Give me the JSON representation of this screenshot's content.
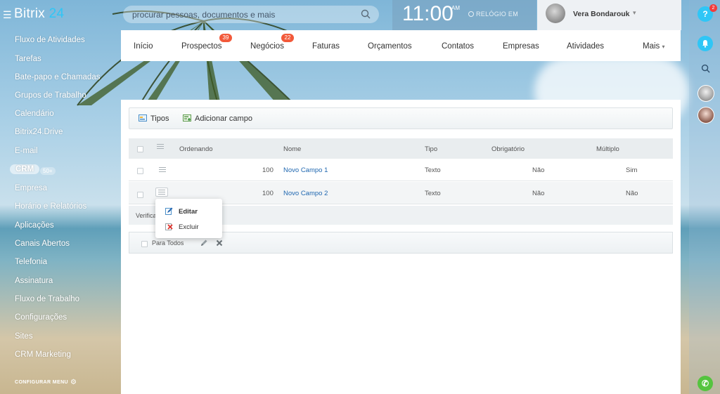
{
  "header": {
    "logo_text": "Bitrix",
    "logo_num": "24",
    "search_placeholder": "procurar pessoas, documentos e mais",
    "clock_time": "11:00",
    "clock_ampm": "AM",
    "clock_label": "RELÓGIO EM",
    "user_name": "Vera Bondarouk"
  },
  "left_menu": {
    "items": [
      "Fluxo de Atividades",
      "Tarefas",
      "Bate-papo e Chamadas",
      "Grupos de Trabalho",
      "Calendário",
      "Bitrix24.Drive",
      "E-mail",
      "CRM",
      "Empresa",
      "Horário e Relatórios",
      "Aplicações",
      "Canais Abertos",
      "Telefonia",
      "Assinatura",
      "Fluxo de Trabalho",
      "Configurações",
      "Sites",
      "CRM Marketing"
    ],
    "crm_badge": "50+",
    "configure_label": "CONFIGURAR MENU"
  },
  "right_panel": {
    "help_icon": "question-icon",
    "help_badge": "2"
  },
  "top_nav": {
    "items": [
      "Início",
      "Prospectos",
      "Negócios",
      "Faturas",
      "Orçamentos",
      "Contatos",
      "Empresas",
      "Atividades",
      "Mais"
    ],
    "prospectos_counter": "39",
    "negocios_counter": "22"
  },
  "toolbar": {
    "types_label": "Tipos",
    "add_field_label": "Adicionar campo"
  },
  "grid": {
    "columns": [
      "Ordenando",
      "Nome",
      "Tipo",
      "Obrigatório",
      "Múltiplo"
    ],
    "rows": [
      {
        "order": "100",
        "name": "Novo Campo 1",
        "type": "Texto",
        "required": "Não",
        "multiple": "Sim"
      },
      {
        "order": "100",
        "name": "Novo Campo 2",
        "type": "Texto",
        "required": "Não",
        "multiple": "Não"
      }
    ],
    "verify_label": "Verifica",
    "footer_label": "Para Todos"
  },
  "context_menu": {
    "edit_label": "Editar",
    "delete_label": "Excluir"
  },
  "colors": {
    "accent": "#2fc6f6",
    "counter": "#f2593a",
    "link": "#1f67b0",
    "call_button": "#55c43f"
  }
}
